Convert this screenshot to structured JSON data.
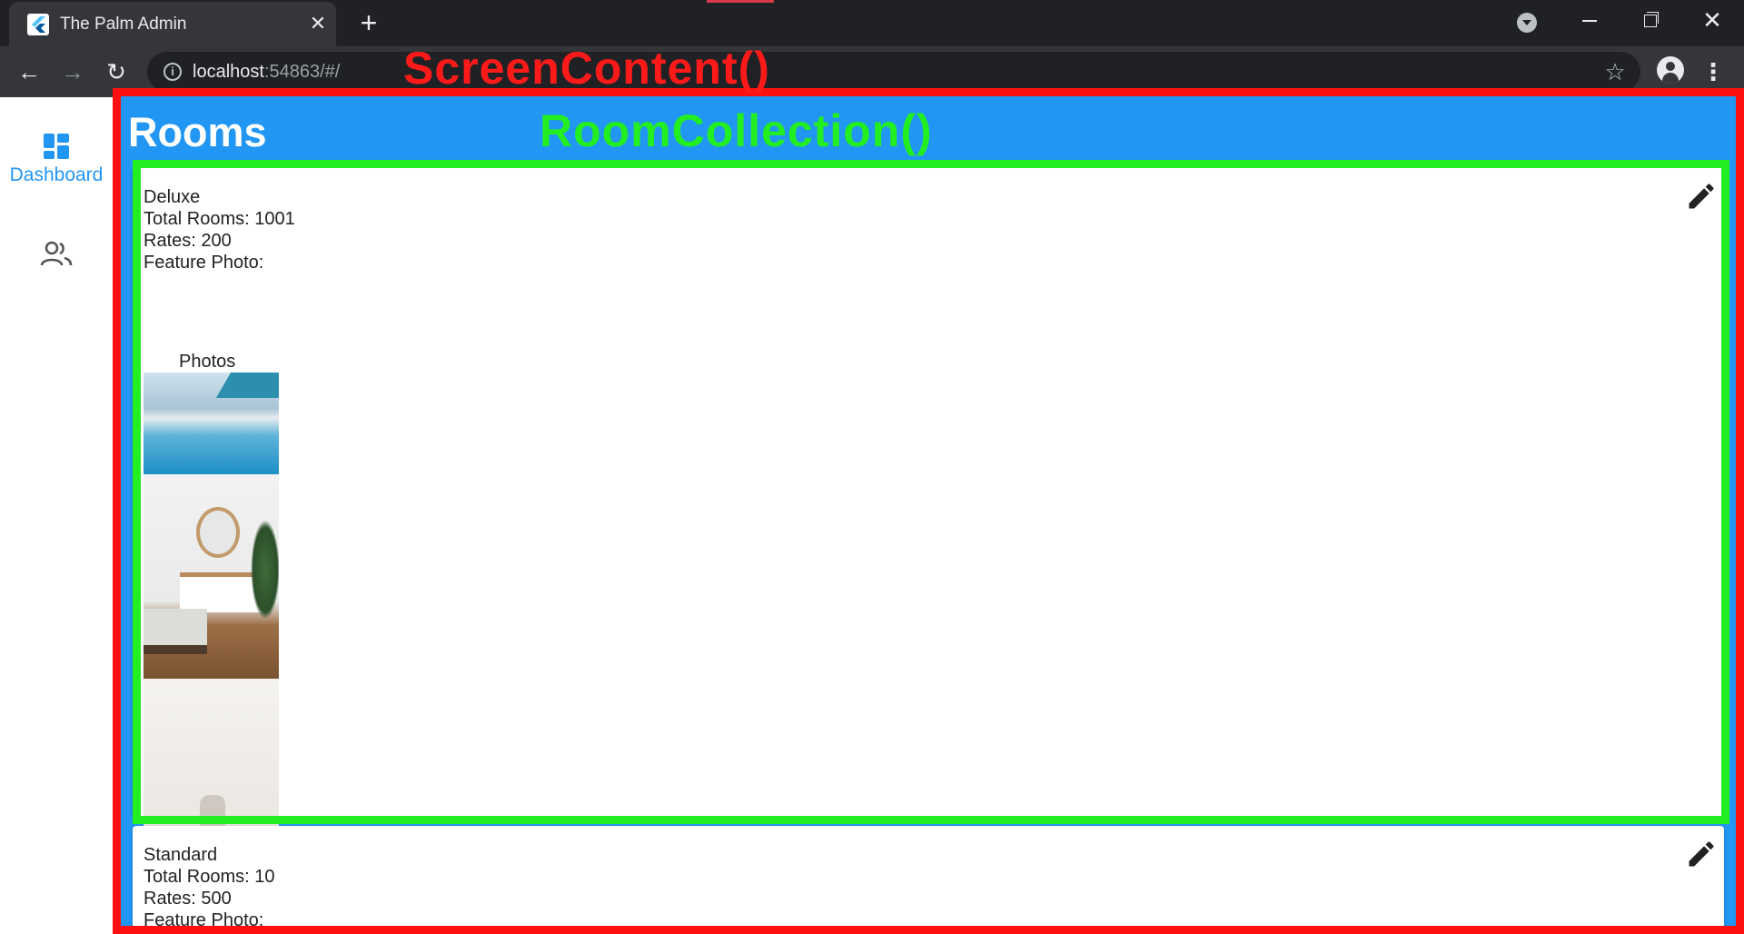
{
  "browser": {
    "tab_title": "The Palm Admin",
    "tab_close_glyph": "✕",
    "new_tab_glyph": "+",
    "url_host": "localhost",
    "url_rest": ":54863/#/",
    "info_glyph": "i",
    "back_glyph": "←",
    "forward_glyph": "→",
    "reload_glyph": "↻",
    "star_glyph": "☆",
    "menu_glyph": "⋮",
    "close_window_glyph": "✕"
  },
  "annotations": {
    "screen_content": "ScreenContent()",
    "room_collection": "RoomCollection()",
    "screen_color": "#ff1010",
    "collection_color": "#22ee22"
  },
  "nav_rail": {
    "items": [
      {
        "label": "Dashboard",
        "icon": "dashboard-icon",
        "selected": true
      },
      {
        "label": "",
        "icon": "people-icon",
        "selected": false
      }
    ],
    "accent": "#2196f3"
  },
  "page": {
    "title": "Rooms",
    "background": "#2196f3"
  },
  "rooms": [
    {
      "name": "Deluxe",
      "total_rooms": "Total Rooms: 1001",
      "rates": "Rates: 200",
      "feature_photo": "Feature Photo:",
      "photos_label": "Photos",
      "photos": [
        "pool-photo",
        "bedroom-photo",
        "dining-photo"
      ]
    },
    {
      "name": "Standard",
      "total_rooms": "Total Rooms: 10",
      "rates": "Rates: 500",
      "feature_photo": "Feature Photo:"
    }
  ]
}
